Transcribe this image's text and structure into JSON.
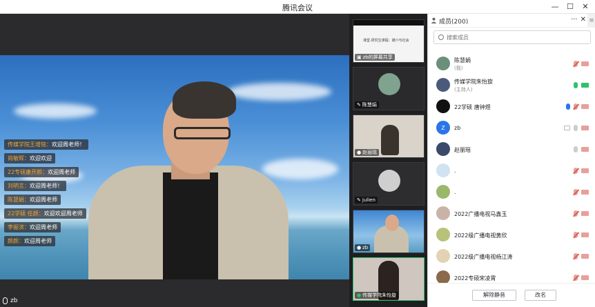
{
  "window": {
    "title": "腾讯会议"
  },
  "main_video": {
    "speaker_label": "zb",
    "chat": [
      {
        "who": "传媒学院王增铭：",
        "msg": "欢迎周老师！"
      },
      {
        "who": "尚敏辉：",
        "msg": "欢迎欢迎"
      },
      {
        "who": "22专硕康开颜：",
        "msg": "欢迎周老师"
      },
      {
        "who": "刘明言：",
        "msg": "欢迎周老师！"
      },
      {
        "who": "陈慧娟：",
        "msg": "欢迎周老师"
      },
      {
        "who": "22学硕 任颜：",
        "msg": "欢迎欢迎周老师"
      },
      {
        "who": "李振滨：",
        "msg": "欢迎周老师"
      },
      {
        "who": "颜颜：",
        "msg": "欢迎周老师"
      }
    ]
  },
  "thumbnails": [
    {
      "label": "zb的屏幕共享",
      "screen_text": "课堂·研究生课程：媒介与社会"
    },
    {
      "label": "陈慧娟"
    },
    {
      "label": "赵丽瑶"
    },
    {
      "label": "julien"
    },
    {
      "label": "zb"
    },
    {
      "label": "传媒学院朱怡旋"
    }
  ],
  "members_panel": {
    "title": "成员(200)",
    "search_placeholder": "搜索成员",
    "members": [
      {
        "name": "陈慧娟",
        "role": "(我)",
        "avatar_color": "#6b8f7a",
        "mic": "muted",
        "cam": "muted"
      },
      {
        "name": "传媒学院朱怡旋",
        "role": "(主持人)",
        "avatar_color": "#4a5a7a",
        "mic": "on",
        "cam": "on"
      },
      {
        "name": "22学硕 唐钟煜",
        "role": "",
        "avatar_color": "#111111",
        "mic": "muted",
        "cam": "muted",
        "hand": true
      },
      {
        "name": "zb",
        "role": "",
        "avatar_color": "#2b74e8",
        "avatar_text": "Z",
        "mic": "off",
        "cam": "muted",
        "screen": true
      },
      {
        "name": "赵丽瑶",
        "role": "",
        "avatar_color": "#3a4a6a",
        "mic": "off",
        "cam": "muted"
      },
      {
        "name": ".",
        "role": "",
        "avatar_color": "#cfe3f0",
        "mic": "muted",
        "cam": "muted"
      },
      {
        "name": ".",
        "role": "",
        "avatar_color": "#9ab86a",
        "mic": "muted",
        "cam": "muted"
      },
      {
        "name": "2022广播电视马鑫玉",
        "role": "",
        "avatar_color": "#c9b3a8",
        "mic": "muted",
        "cam": "muted"
      },
      {
        "name": "2022级广播电视黄欣",
        "role": "",
        "avatar_color": "#b8c27a",
        "mic": "muted",
        "cam": "muted"
      },
      {
        "name": "2022级广播电视杨江涛",
        "role": "",
        "avatar_color": "#e3d2b4",
        "mic": "muted",
        "cam": "muted"
      },
      {
        "name": "2022专硕宋凌霄",
        "role": "",
        "avatar_color": "#8a6a4a",
        "mic": "muted",
        "cam": "muted"
      }
    ],
    "buttons": {
      "mute_all": "解除静音",
      "rename": "改名"
    }
  }
}
